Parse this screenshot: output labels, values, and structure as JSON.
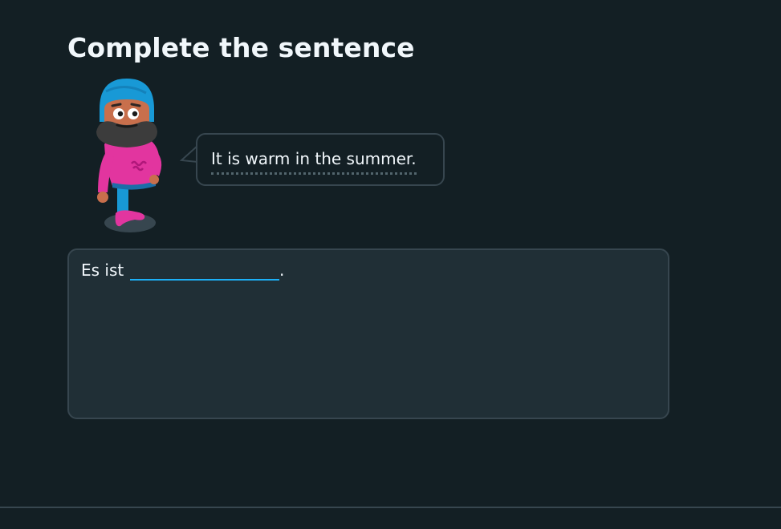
{
  "challenge": {
    "title": "Complete the sentence",
    "prompt": "It is warm in the summer.",
    "answer": {
      "prefix": "Es ist",
      "input_value": "",
      "suffix": "."
    }
  },
  "colors": {
    "background": "#131f24",
    "panel": "#202f36",
    "border": "#37464f",
    "text": "#f1f7fb",
    "input_accent": "#1cb0f6"
  },
  "icons": {
    "character": "turban-character-icon",
    "bubble_tail": "speech-bubble-tail-icon"
  }
}
